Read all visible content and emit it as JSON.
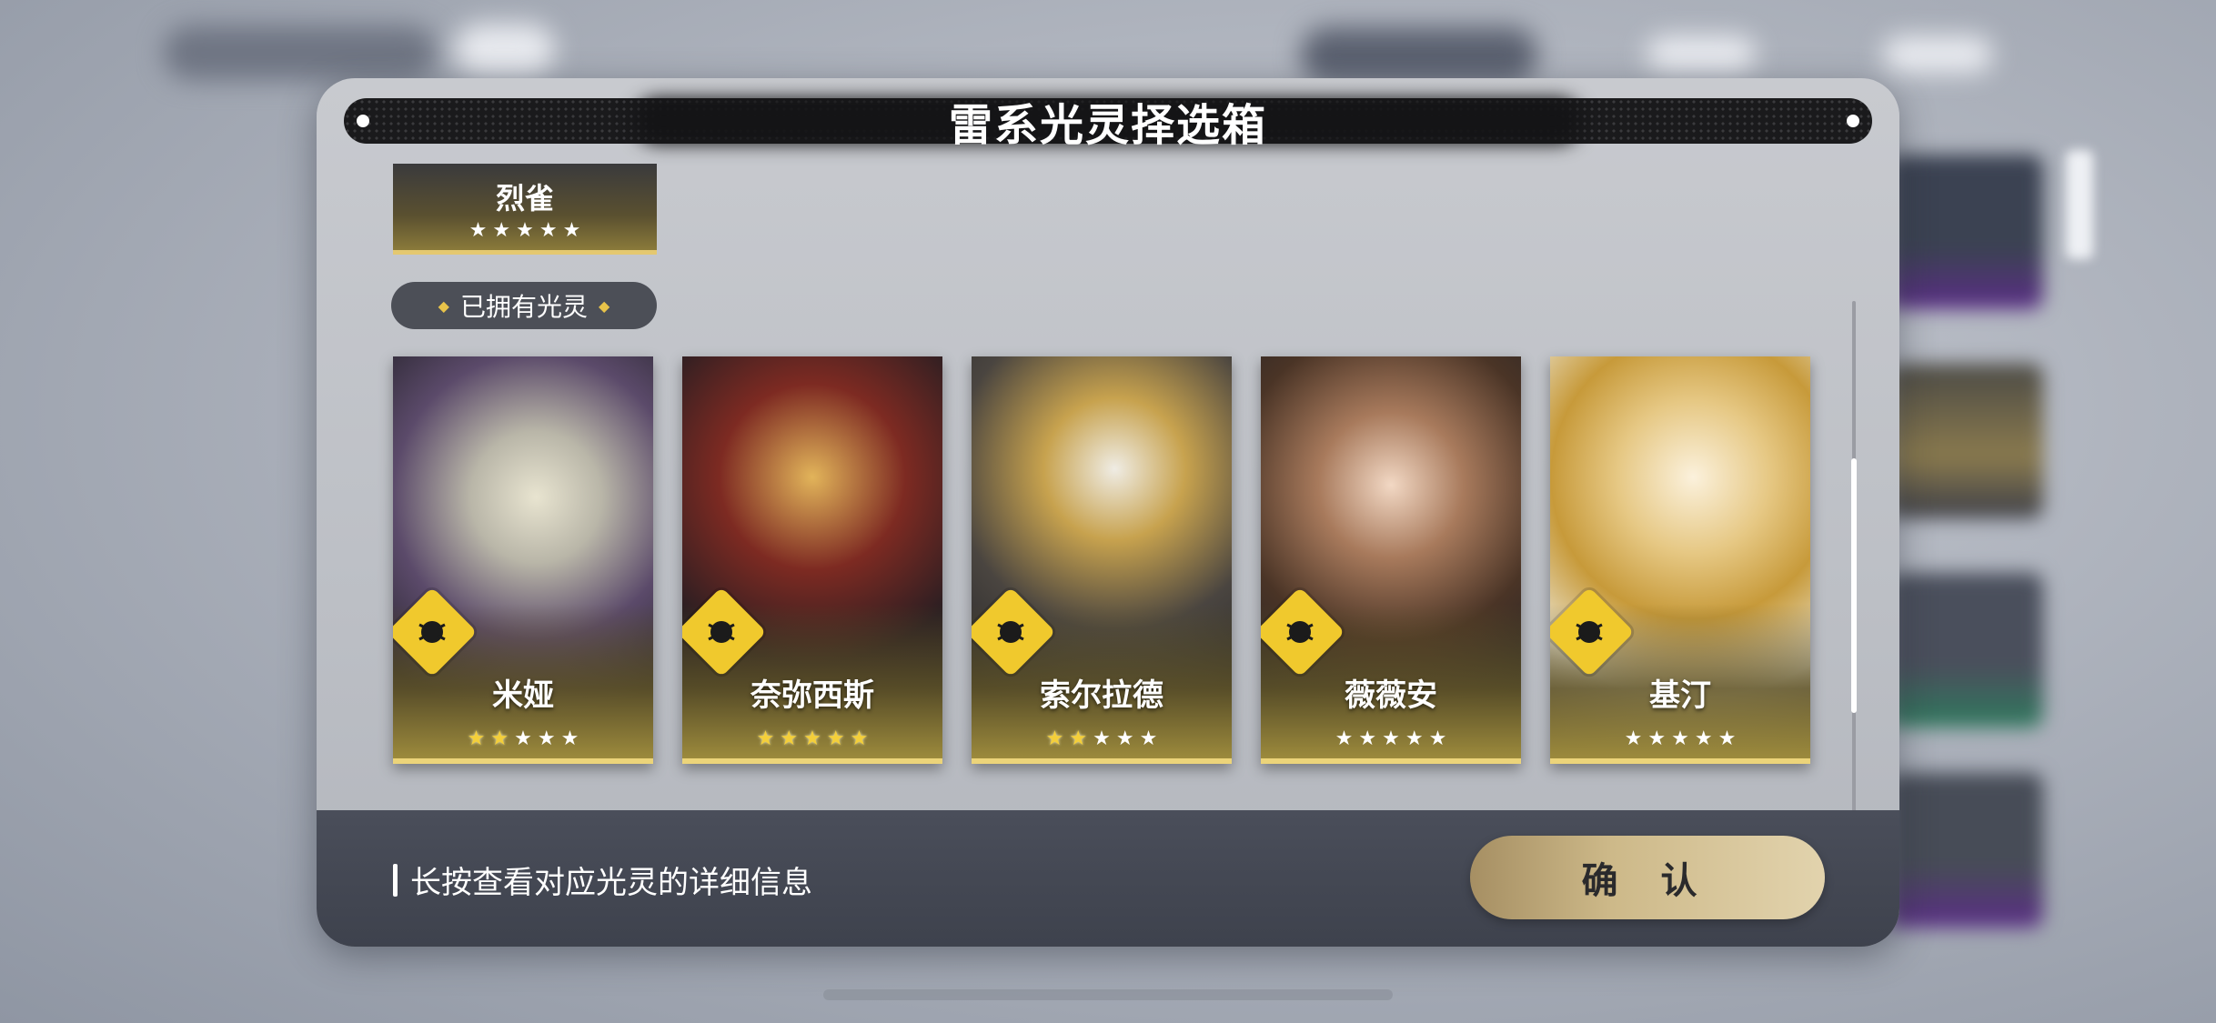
{
  "dialog": {
    "title": "雷系光灵择选箱",
    "partial_card": {
      "name": "烈雀",
      "rarity": 0,
      "max_stars": 5
    },
    "owned_section_label": "已拥有光灵",
    "element_icon": "thunder-element-icon",
    "cards": [
      {
        "name": "米娅",
        "rarity": 2,
        "max_stars": 5
      },
      {
        "name": "奈弥西斯",
        "rarity": 5,
        "max_stars": 5
      },
      {
        "name": "索尔拉德",
        "rarity": 2,
        "max_stars": 5
      },
      {
        "name": "薇薇安",
        "rarity": 0,
        "max_stars": 5
      },
      {
        "name": "基汀",
        "rarity": 0,
        "max_stars": 5
      }
    ],
    "scroll_position": 0.45
  },
  "footer": {
    "hint": "长按查看对应光灵的详细信息",
    "confirm_label": "确 认"
  },
  "colors": {
    "accent_gold": "#ecd47a",
    "star_gold": "#f4cf3a",
    "element_yellow": "#f0c92d",
    "button_gold": "#cdb989"
  }
}
